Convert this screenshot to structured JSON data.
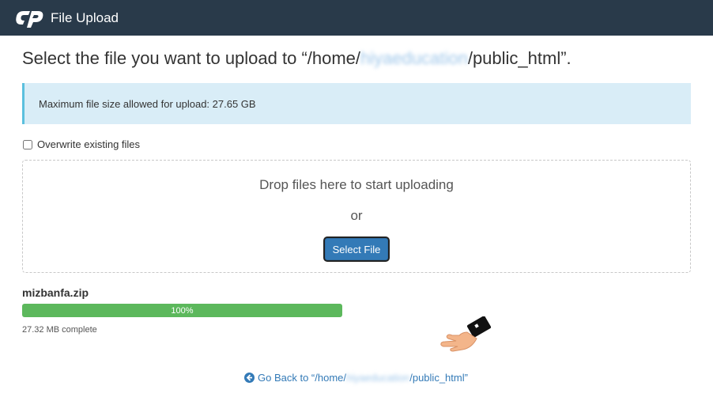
{
  "header": {
    "logo_icon": "cpanel-logo-icon",
    "title": "File Upload"
  },
  "heading": {
    "prefix": "Select the file you want to upload to “/home/",
    "user": "hiyaeducation",
    "suffix": "/public_html”."
  },
  "alert": {
    "text": "Maximum file size allowed for upload: 27.65 GB"
  },
  "overwrite": {
    "label": "Overwrite existing files",
    "checked": false
  },
  "dropzone": {
    "drop_text": "Drop files here to start uploading",
    "or_text": "or",
    "button_label": "Select File"
  },
  "upload": {
    "filename": "mizbanfa.zip",
    "progress_percent": 100,
    "progress_label": "100%",
    "status": "27.32 MB complete"
  },
  "back_link": {
    "prefix": "Go Back to “/home/",
    "user": "hiyaeducation",
    "suffix": "/public_html”",
    "icon": "arrow-circle-left-icon"
  },
  "colors": {
    "topbar": "#293a4a",
    "alert_bg": "#d9edf7",
    "progress": "#5cb85c",
    "button": "#337ab7",
    "link": "#337ab7"
  }
}
